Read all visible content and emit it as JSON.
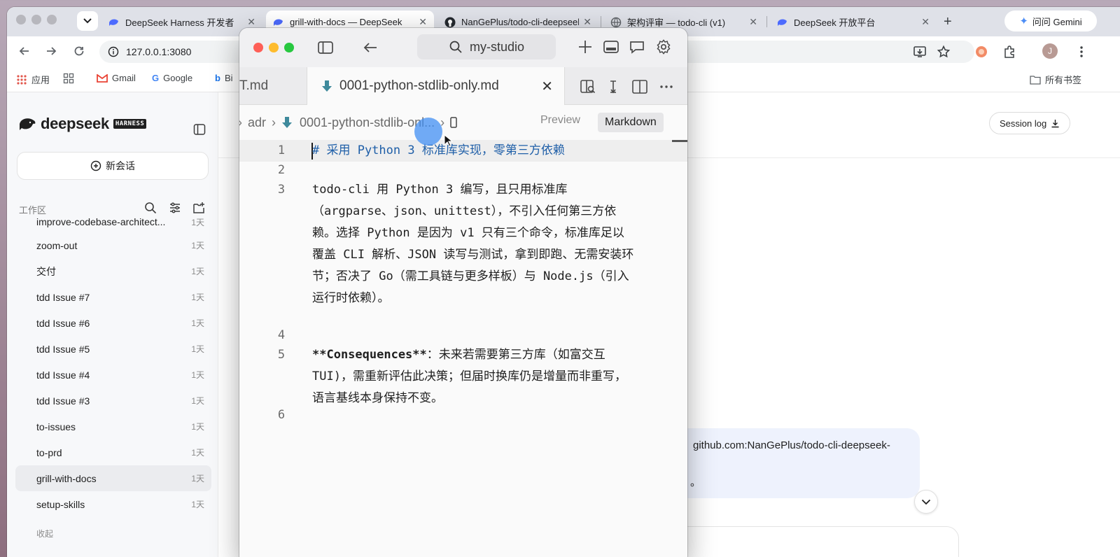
{
  "browser": {
    "tabs": [
      {
        "title": "DeepSeek Harness 开发者",
        "favicon": "deepseek-whale-icon"
      },
      {
        "title": "grill-with-docs — DeepSeek",
        "favicon": "deepseek-whale-icon"
      },
      {
        "title": "NanGePlus/todo-cli-deepseek",
        "favicon": "github-icon"
      },
      {
        "title": "架构评审 — todo-cli (v1)",
        "favicon": "globe-icon"
      },
      {
        "title": "DeepSeek 开放平台",
        "favicon": "deepseek-whale-icon"
      }
    ],
    "gemini_label": "问问 Gemini",
    "url": "127.0.0.1:3080",
    "profile_initial": "J",
    "bookmarks": {
      "apps": "应用",
      "gmail": "Gmail",
      "google": "Google",
      "bing": "Bi",
      "all_bookmarks": "所有书签"
    }
  },
  "harness": {
    "logo_text": "deepseek",
    "logo_badge": "HARNESS",
    "new_chat": "新会话",
    "workspace_label": "工作区",
    "sessions": [
      {
        "name": "improve-codebase-architect...",
        "age": "1天"
      },
      {
        "name": "zoom-out",
        "age": "1天"
      },
      {
        "name": "交付",
        "age": "1天"
      },
      {
        "name": "tdd Issue #7",
        "age": "1天"
      },
      {
        "name": "tdd Issue #6",
        "age": "1天"
      },
      {
        "name": "tdd Issue #5",
        "age": "1天"
      },
      {
        "name": "tdd Issue #4",
        "age": "1天"
      },
      {
        "name": "tdd Issue #3",
        "age": "1天"
      },
      {
        "name": "to-issues",
        "age": "1天"
      },
      {
        "name": "to-prd",
        "age": "1天"
      },
      {
        "name": "grill-with-docs",
        "age": "1天"
      },
      {
        "name": "setup-skills",
        "age": "1天"
      }
    ],
    "active_session": "grill-with-docs",
    "collapse_label": "收起",
    "session_log_label": "Session log",
    "message_fragment": "github.com:NanGePlus/todo-cli-deepseek-",
    "message_punct": "。"
  },
  "studio": {
    "search_label": "my-studio",
    "prev_tab": "T.md",
    "active_tab": "0001-python-stdlib-only.md",
    "breadcrumb": [
      "adr",
      "0001-python-stdlib-onl..."
    ],
    "mode_preview": "Preview",
    "mode_markdown": "Markdown",
    "lines": [
      {
        "no": "1",
        "text": "# 采用 Python 3 标准库实现，零第三方依赖"
      },
      {
        "no": "2",
        "text": ""
      },
      {
        "no": "3",
        "text": "todo-cli 用 Python 3 编写，且只用标准库（argparse、json、unittest），不引入任何第三方依赖。选择 Python 是因为 v1 只有三个命令，标准库足以覆盖 CLI 解析、JSON 读写与测试，拿到即跑、无需安装环节；否决了 Go（需工具链与更多样板）与 Node.js（引入运行时依赖）。"
      },
      {
        "no": "4",
        "text": ""
      },
      {
        "no": "5",
        "bold": "**Consequences**",
        "text": "：未来若需要第三方库（如富交互 TUI），需重新评估此决策；但届时换库仍是增量而非重写，语言基线本身保持不变。"
      },
      {
        "no": "6",
        "text": ""
      }
    ],
    "line3_rows": [
      "todo-cli 用 Python 3 编写，且只用标准库",
      "（argparse、json、unittest），不引入任何第三方依",
      "赖。选择 Python 是因为 v1 只有三个命令，标准库足以",
      "覆盖 CLI 解析、JSON 读写与测试，拿到即跑、无需安装环",
      "节；否决了 Go（需工具链与更多样板）与 Node.js（引入",
      "运行时依赖）。"
    ],
    "line5_rows": [
      "：未来若需要第三方库（如富交互",
      "TUI)，需重新评估此决策；但届时换库仍是增量而非重写，",
      "语言基线本身保持不变。"
    ]
  },
  "colors": {
    "h1": "#1f5fa8",
    "cursor": "#428ff3",
    "bubble": "#eef2fd"
  }
}
